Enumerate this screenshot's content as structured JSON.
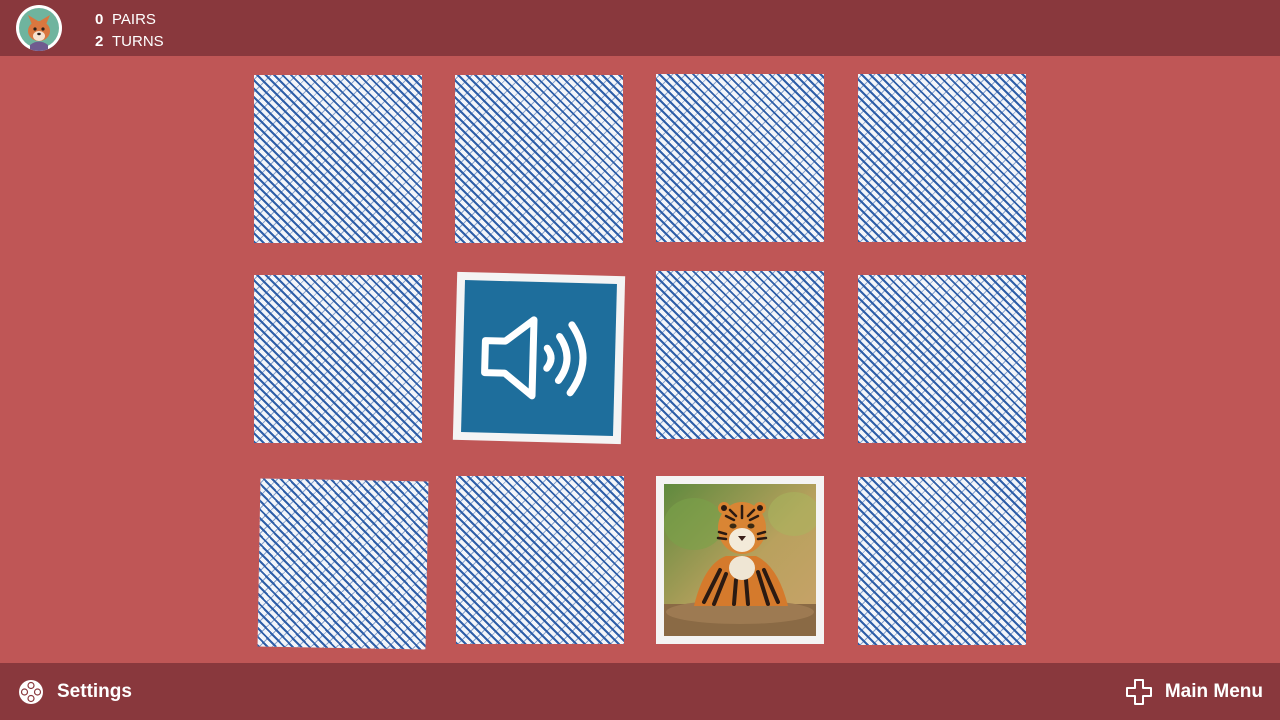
{
  "header": {
    "avatar_icon": "fox-avatar-icon",
    "pairs": {
      "value": "0",
      "label": "PAIRS"
    },
    "turns": {
      "value": "2",
      "label": "TURNS"
    }
  },
  "footer": {
    "settings": {
      "label": "Settings",
      "icon": "gamepad-buttons-icon"
    },
    "main_menu": {
      "label": "Main Menu",
      "icon": "dpad-icon"
    }
  },
  "board": {
    "rows": 3,
    "columns": 4,
    "cards": [
      {
        "state": "face-down"
      },
      {
        "state": "face-down"
      },
      {
        "state": "face-down"
      },
      {
        "state": "face-down"
      },
      {
        "state": "face-down"
      },
      {
        "state": "face-up",
        "content": "speaker-sound-icon"
      },
      {
        "state": "face-down"
      },
      {
        "state": "face-down"
      },
      {
        "state": "face-down"
      },
      {
        "state": "face-down"
      },
      {
        "state": "face-up",
        "content": "tiger-photo"
      },
      {
        "state": "face-down"
      }
    ]
  },
  "colors": {
    "background": "#bf5656",
    "bars": "#89383d",
    "sound_card": "#1e6e9c",
    "card_pattern": "#2f5fa8"
  }
}
